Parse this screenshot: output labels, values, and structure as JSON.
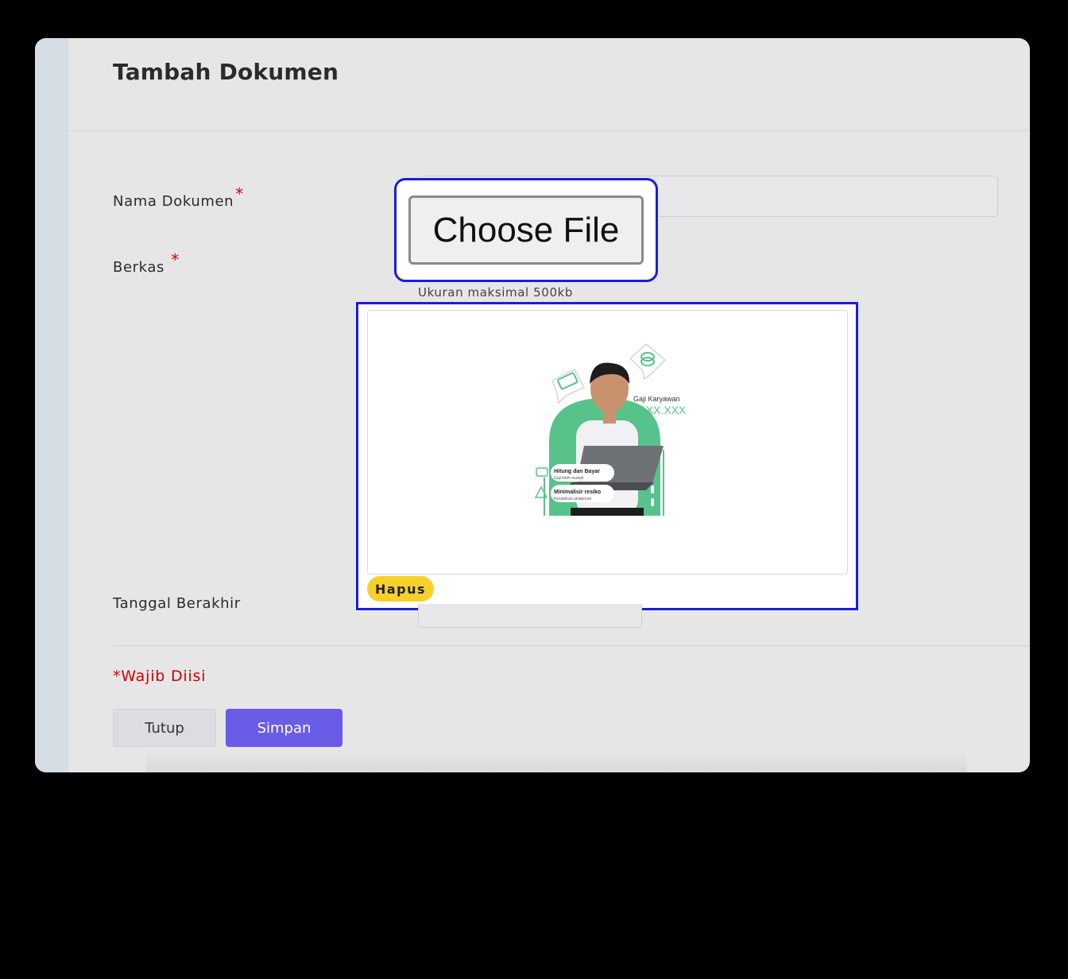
{
  "modal": {
    "title": "Tambah Dokumen"
  },
  "form": {
    "name_label": "Nama Dokumen",
    "required_mark": "*",
    "file_label": "Berkas",
    "file_button": "Choose File",
    "file_hint": "Ukuran maksimal 500kb",
    "remove_button": "Hapus",
    "end_date_label": "Tanggal Berakhir",
    "required_note": "*Wajib Diisi"
  },
  "preview": {
    "image_desc": "preview-image",
    "caption_title": "Gaji Karyawan",
    "caption_value": "Rp XX.XXX",
    "card1_title": "Hitung dan Bayar",
    "card1_sub": "Gaji lebih mudah",
    "card2_title": "Minimalisir resiko",
    "card2_sub": "Kesalahan pelaporan"
  },
  "actions": {
    "close": "Tutup",
    "save": "Simpan"
  },
  "colors": {
    "accent": "#6b5ce7",
    "highlight": "#1a1ed8",
    "required": "#d40000",
    "remove": "#f7d12b",
    "brand_green": "#57c28a"
  }
}
